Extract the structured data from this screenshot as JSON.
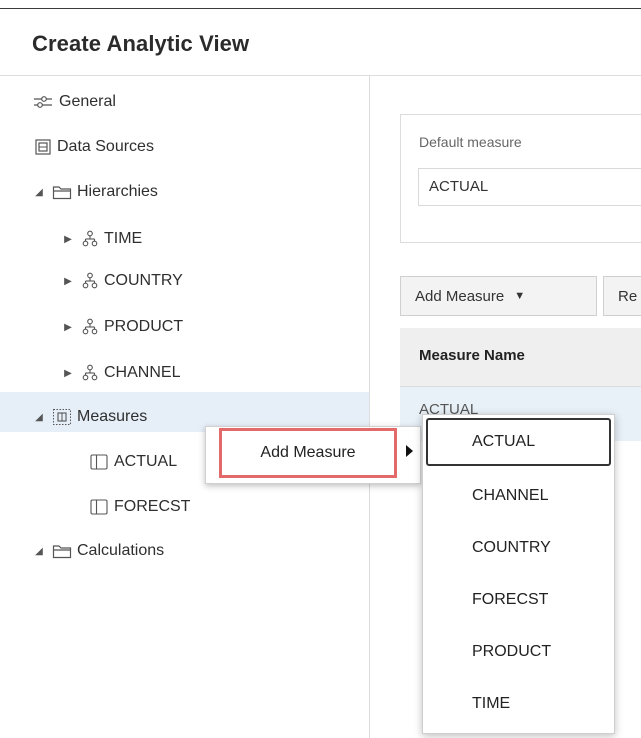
{
  "header": {
    "title": "Create Analytic View"
  },
  "tree": {
    "general": "General",
    "data_sources": "Data Sources",
    "hierarchies": "Hierarchies",
    "time": "TIME",
    "country": "COUNTRY",
    "product": "PRODUCT",
    "channel": "CHANNEL",
    "measures": "Measures",
    "actual": "ACTUAL",
    "forecst": "FORECST",
    "calculations": "Calculations"
  },
  "panel": {
    "default_measure_label": "Default measure",
    "default_measure_value": "ACTUAL",
    "add_measure_button": "Add Measure",
    "second_button_label": "Re",
    "table_header": "Measure Name",
    "table_row_partial": "ACTUAL"
  },
  "context_menu": {
    "item": "Add Measure"
  },
  "submenu": {
    "items": [
      "ACTUAL",
      "CHANNEL",
      "COUNTRY",
      "FORECST",
      "PRODUCT",
      "TIME"
    ]
  }
}
